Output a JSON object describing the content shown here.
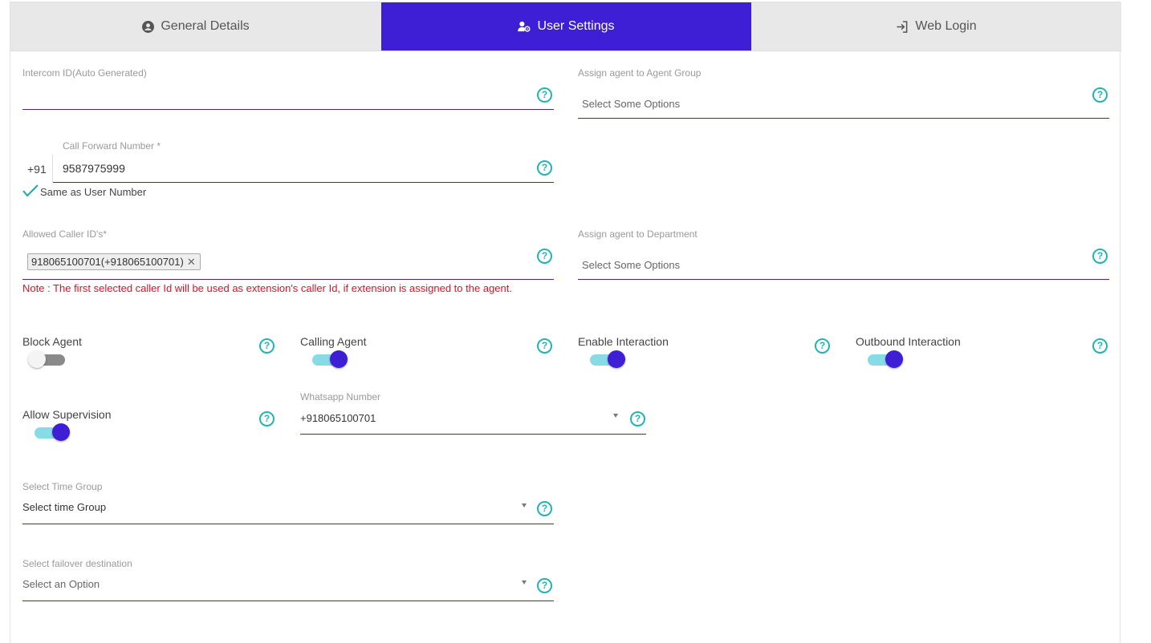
{
  "tabs": [
    {
      "label": "General Details",
      "icon": "user-circle-icon",
      "active": false
    },
    {
      "label": "User Settings",
      "icon": "user-cog-icon",
      "active": true
    },
    {
      "label": "Web Login",
      "icon": "sign-in-icon",
      "active": false
    }
  ],
  "intercom": {
    "label": "Intercom ID(Auto Generated)",
    "value": ""
  },
  "agent_group": {
    "label": "Assign agent to Agent Group",
    "placeholder": "Select Some Options"
  },
  "call_forward": {
    "label": "Call Forward Number *",
    "prefix": "+91",
    "value": "9587975999",
    "same_as_label": "Same as User Number",
    "same_as_checked": true
  },
  "caller_ids": {
    "label": "Allowed Caller ID's*",
    "chips": [
      "918065100701(+918065100701)"
    ],
    "note": "Note : The first selected caller Id will be used as extension's caller Id, if extension is assigned to the agent."
  },
  "department": {
    "label": "Assign agent to Department",
    "placeholder": "Select Some Options"
  },
  "toggles": {
    "block_agent": {
      "label": "Block Agent",
      "on": false
    },
    "calling_agent": {
      "label": "Calling Agent",
      "on": true
    },
    "enable_interaction": {
      "label": "Enable Interaction",
      "on": true
    },
    "outbound_interaction": {
      "label": "Outbound Interaction",
      "on": true
    },
    "allow_supervision": {
      "label": "Allow Supervision",
      "on": true
    }
  },
  "whatsapp": {
    "label": "Whatsapp Number",
    "value": "+918065100701"
  },
  "time_group": {
    "label": "Select Time Group",
    "value": "Select time Group"
  },
  "failover": {
    "label": "Select failover destination",
    "value": "Select an Option"
  },
  "help_glyph": "?",
  "colors": {
    "accent": "#3f1fd6",
    "help": "#1fb5b5",
    "note": "#e0102a",
    "toggle_track_on": "#86dbe6"
  }
}
